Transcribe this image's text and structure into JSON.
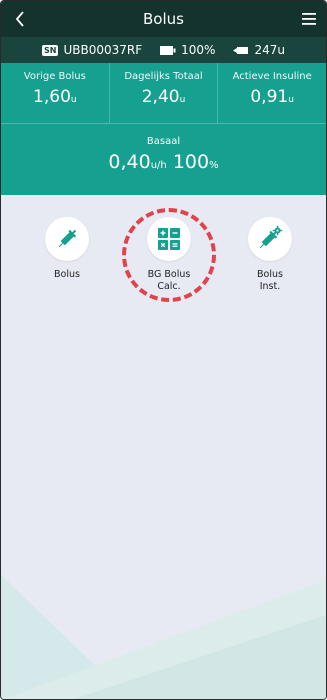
{
  "header": {
    "title": "Bolus"
  },
  "status": {
    "sn_badge": "SN",
    "serial": "UBB00037RF",
    "battery": "100%",
    "reservoir": "247u"
  },
  "stats": [
    {
      "label": "Vorige Bolus",
      "value": "1,60",
      "unit": "u"
    },
    {
      "label": "Dagelijks Totaal",
      "value": "2,40",
      "unit": "u"
    },
    {
      "label": "Actieve Insuline",
      "value": "0,91",
      "unit": "u"
    }
  ],
  "basaal": {
    "label": "Basaal",
    "rate": "0,40",
    "rate_unit": "u/h",
    "percent": "100",
    "percent_unit": "%"
  },
  "actions": [
    {
      "label": "Bolus",
      "icon": "syringe-icon"
    },
    {
      "label": "BG Bolus\nCalc.",
      "icon": "calculator-icon"
    },
    {
      "label": "Bolus\nInst.",
      "icon": "syringe-gear-icon"
    }
  ],
  "colors": {
    "topbar": "#14332f",
    "statusbar": "#19453e",
    "accent": "#15a08f",
    "background": "#e7eaf3",
    "highlight": "#e2434a"
  }
}
